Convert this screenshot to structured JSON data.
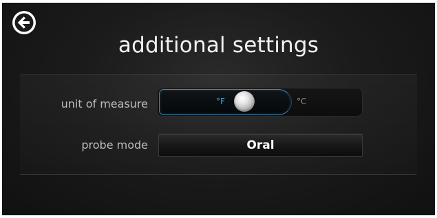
{
  "header": {
    "back_icon": "arrow-left-circle-icon",
    "title": "additional settings"
  },
  "settings": {
    "unit_of_measure": {
      "label": "unit of measure",
      "options": [
        "°F",
        "°C"
      ],
      "option_f": "°F",
      "option_c": "°C",
      "selected": "°F"
    },
    "probe_mode": {
      "label": "probe mode",
      "value": "Oral"
    }
  },
  "colors": {
    "accent": "#3fa3d8",
    "background": "#1b1b1b",
    "text": "#e9e9e9"
  }
}
